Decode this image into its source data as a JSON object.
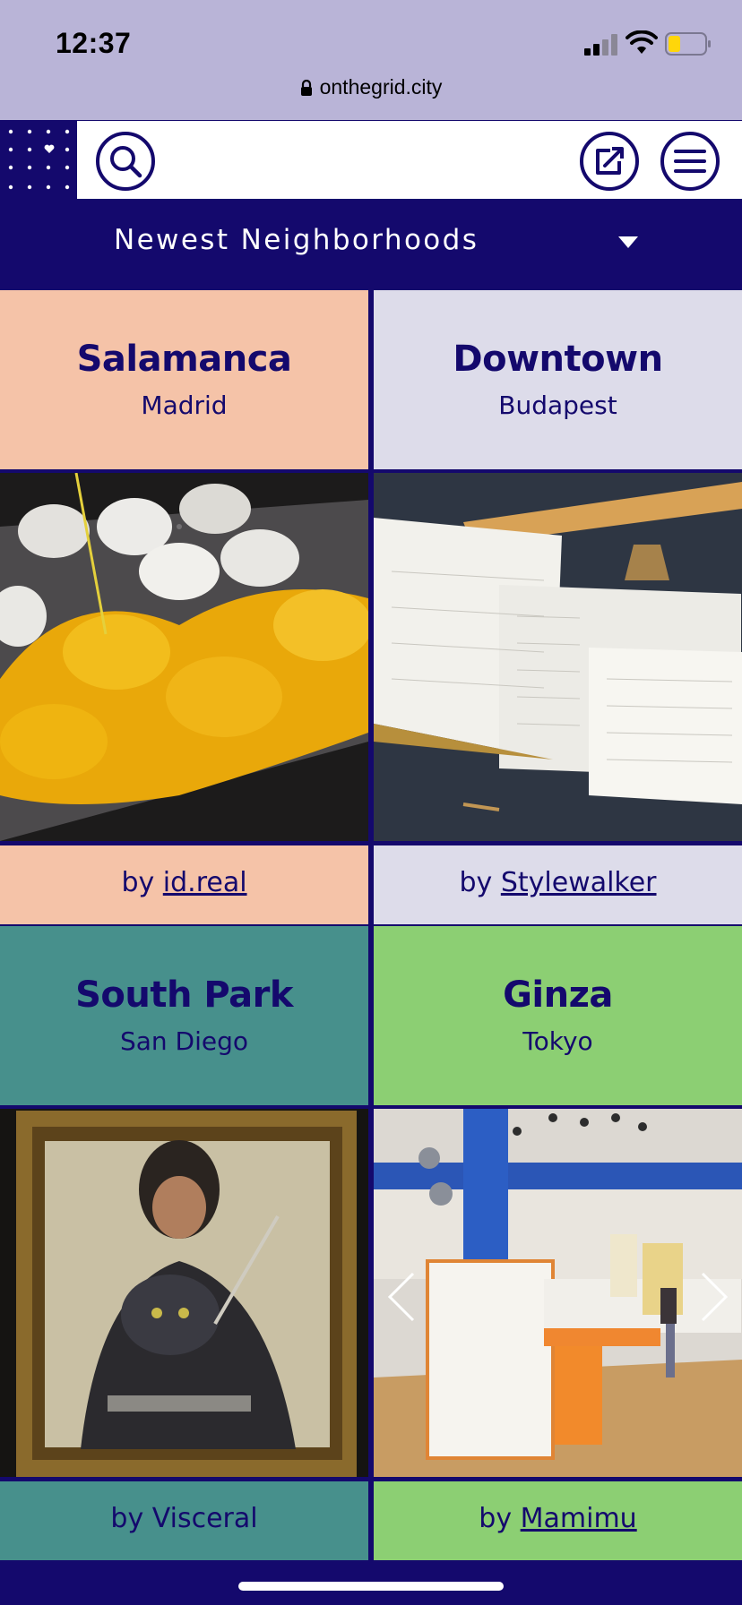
{
  "status_bar": {
    "time": "12:37",
    "url": "onthegrid.city"
  },
  "header": {
    "logo_icon": "dotted-grid-heart-icon",
    "search_icon": "search-icon",
    "share_icon": "share-icon",
    "menu_icon": "hamburger-menu-icon"
  },
  "filter": {
    "label": "Newest Neighborhoods",
    "icon": "caret-down-icon"
  },
  "cards": [
    {
      "name": "Salamanca",
      "city": "Madrid",
      "by_prefix": "by ",
      "author": "id.real",
      "author_linked": true,
      "color": "#f5c3a8",
      "photo": "dessert-photo"
    },
    {
      "name": "Downtown",
      "city": "Budapest",
      "by_prefix": "by ",
      "author": "Stylewalker",
      "author_linked": true,
      "color": "#dddcea",
      "photo": "notebooks-photo"
    },
    {
      "name": "South Park",
      "city": "San Diego",
      "by_prefix": "by ",
      "author": "Visceral",
      "author_linked": false,
      "color": "#47908c",
      "photo": "framed-painting-photo"
    },
    {
      "name": "Ginza",
      "city": "Tokyo",
      "by_prefix": "by ",
      "author": "Mamimu",
      "author_linked": true,
      "color": "#8ccf73",
      "photo": "exhibition-photo"
    }
  ],
  "carousel": {
    "prev_icon": "chevron-left-icon",
    "next_icon": "chevron-right-icon"
  },
  "colors": {
    "brand_navy": "#14096d",
    "status_bar_bg": "#b9b4d7"
  }
}
